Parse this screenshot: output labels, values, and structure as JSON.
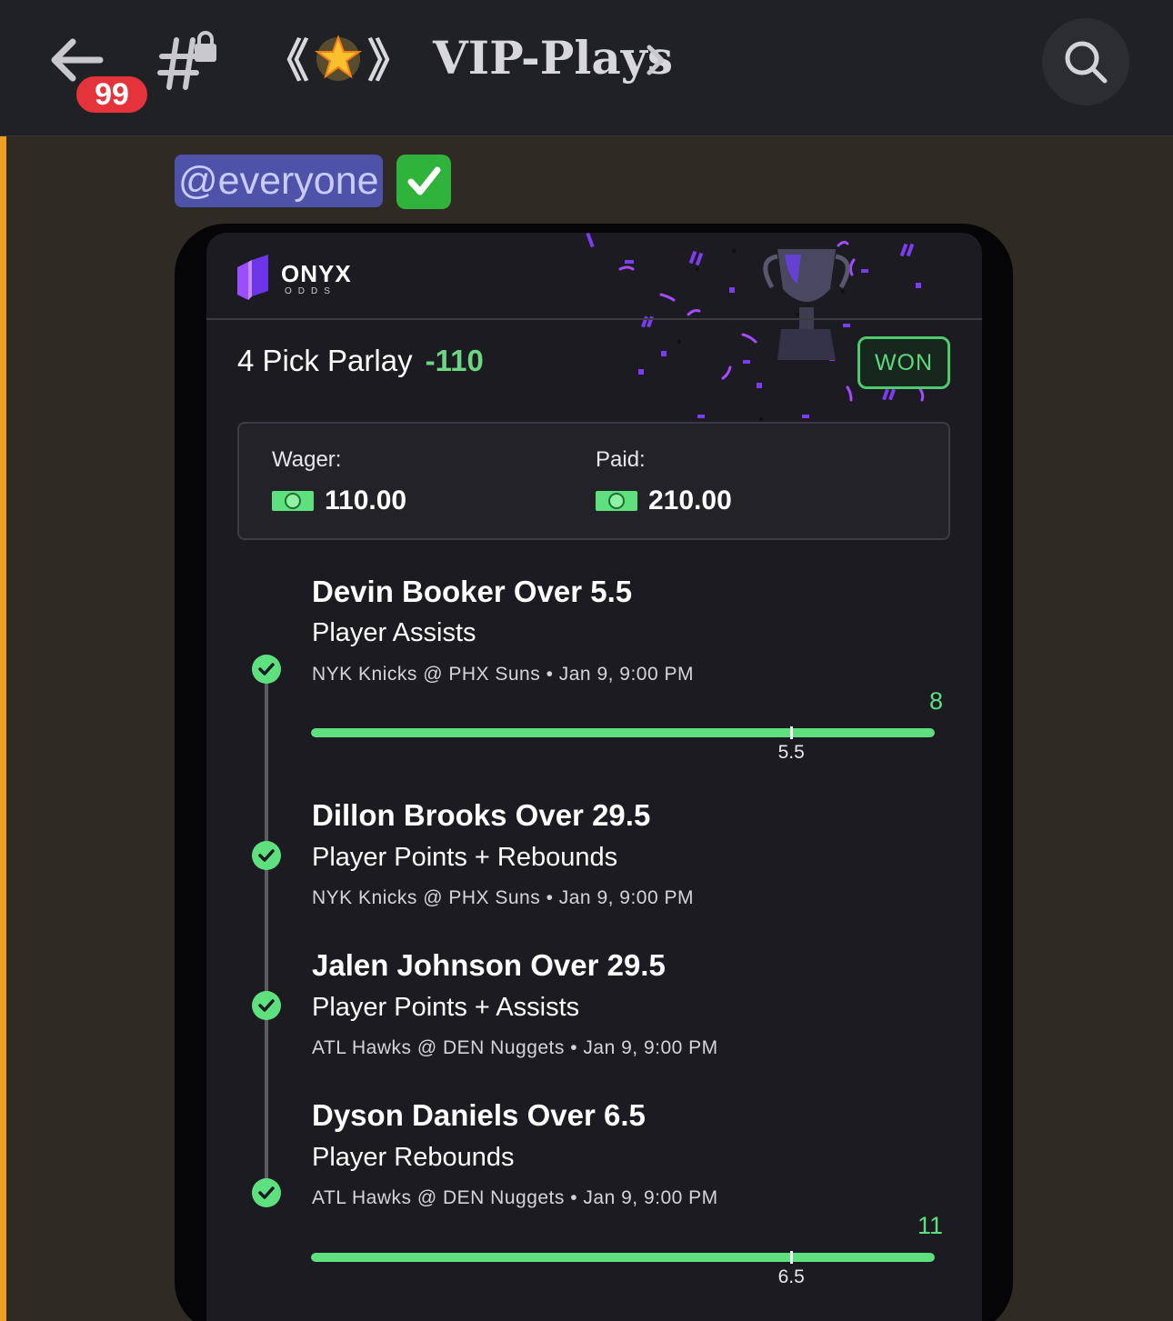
{
  "header": {
    "unread_count": "99",
    "channel_name": "VIP-Plays",
    "bracket_left": "《",
    "bracket_right": "》",
    "icons": [
      "back-arrow-icon",
      "locked-channel-icon",
      "star-emoji-icon",
      "chevron-right-icon",
      "search-icon"
    ]
  },
  "message": {
    "mention": "@everyone",
    "reaction_icon": "check-mark-button-emoji"
  },
  "card": {
    "brand": "ONYX",
    "brand_sub": "ODDS",
    "parlay_title": "4 Pick Parlay",
    "parlay_odds": "-110",
    "status": "WON",
    "wager_label": "Wager:",
    "wager_value": "110.00",
    "paid_label": "Paid:",
    "paid_value": "210.00",
    "colors": {
      "accent_green": "#5ee07e",
      "card_bg": "#1b1b21",
      "mention_bg": "#4e52a8",
      "badge_red": "#e5333b"
    },
    "legs": [
      {
        "title": "Devin Booker Over 5.5",
        "market": "Player Assists",
        "game": "NYK Knicks @ PHX Suns • Jan 9, 9:00 PM",
        "status": "won",
        "progress": {
          "line": 5.5,
          "line_label": "5.5",
          "actual": 8,
          "actual_label": "8",
          "line_fraction": 0.77
        }
      },
      {
        "title": "Dillon Brooks Over 29.5",
        "market": "Player Points + Rebounds",
        "game": "NYK Knicks @ PHX Suns • Jan 9, 9:00 PM",
        "status": "won"
      },
      {
        "title": "Jalen Johnson Over 29.5",
        "market": "Player Points + Assists",
        "game": "ATL Hawks @ DEN Nuggets • Jan 9, 9:00 PM",
        "status": "won"
      },
      {
        "title": "Dyson Daniels Over 6.5",
        "market": "Player Rebounds",
        "game": "ATL Hawks @ DEN Nuggets • Jan 9, 9:00 PM",
        "status": "won",
        "progress": {
          "line": 6.5,
          "line_label": "6.5",
          "actual": 11,
          "actual_label": "11",
          "line_fraction": 0.77
        }
      }
    ]
  }
}
